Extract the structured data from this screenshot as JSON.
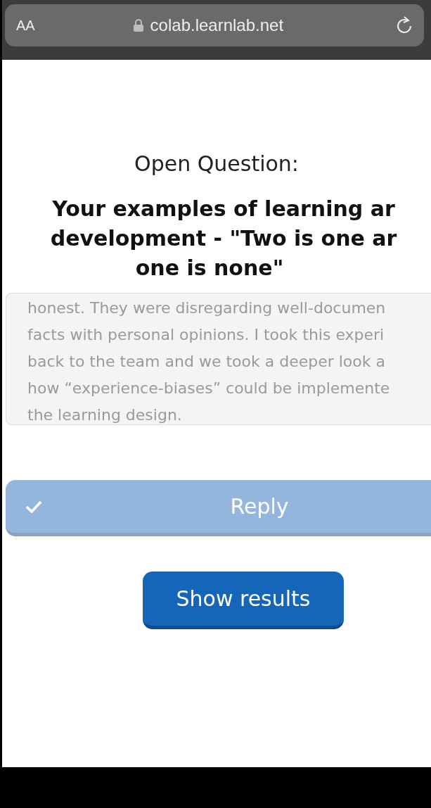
{
  "browser_bar": {
    "text_size_button": "AA",
    "url": "colab.learnlab.net"
  },
  "question": {
    "label": "Open Question:",
    "title_lines": [
      "Your examples of learning ar",
      "development - \"Two is one ar",
      "one is none\""
    ]
  },
  "answer": {
    "lines": [
      "honest. They were disregarding well-documen",
      "facts with personal opinions. I took this experi",
      "back to the team and we took a deeper look a",
      "how “experience-biases” could be implemente",
      "the learning design."
    ]
  },
  "reply_button": {
    "label": "Reply",
    "disabled": true
  },
  "results_button": {
    "label": "Show results"
  }
}
